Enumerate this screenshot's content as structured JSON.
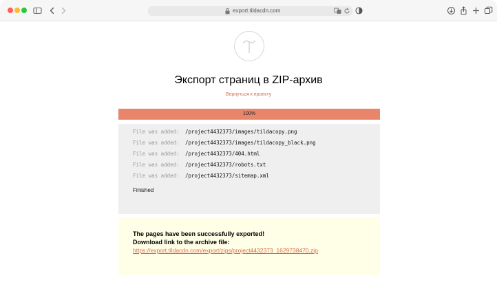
{
  "browser": {
    "address": "export.tildacdn.com"
  },
  "page": {
    "title": "Экспорт страниц в ZIP-архив",
    "back_link": "Вернуться к проекту"
  },
  "progress": {
    "label": "100%",
    "fraction": 1.0
  },
  "log": {
    "prefix": "File was added:",
    "entries": [
      "/project4432373/images/tildacopy.png",
      "/project4432373/images/tildacopy_black.png",
      "/project4432373/404.html",
      "/project4432373/robots.txt",
      "/project4432373/sitemap.xml"
    ],
    "finished": "Finished"
  },
  "result": {
    "line1": "The pages have been successfully exported!",
    "line2": "Download link to the archive file:",
    "link": "https://export.tildacdn.com/export/zips/project4432373_1629738470.zip"
  },
  "colors": {
    "accent": "#e8856a",
    "link": "#d96a4e",
    "log_bg": "#efefef",
    "result_bg": "#fffee6"
  }
}
